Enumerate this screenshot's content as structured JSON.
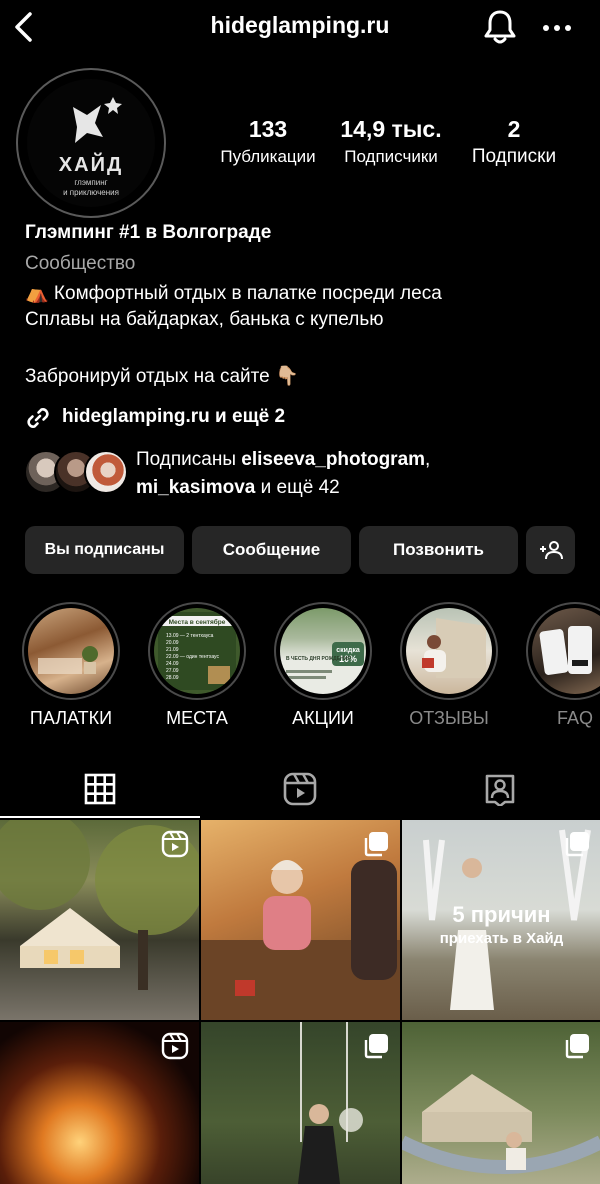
{
  "header": {
    "username": "hideglamping.ru"
  },
  "avatar": {
    "brand": "ХАЙД",
    "tagline1": "глэмпинг",
    "tagline2": "и приключения"
  },
  "stats": {
    "posts": {
      "value": "133",
      "label": "Публикации"
    },
    "followers": {
      "value": "14,9 тыс.",
      "label": "Подписчики"
    },
    "following": {
      "value": "2",
      "label": "Подписки"
    }
  },
  "bio": {
    "name": "Глэмпинг #1 в Волгограде",
    "category": "Сообщество",
    "line1": "⛺ Комфортный отдых в палатке посреди леса",
    "line2": "Сплавы на байдарках, банька с купелью",
    "line3": "Забронируй отдых на сайте 👇🏼"
  },
  "link": {
    "text": "hideglamping.ru и ещё 2"
  },
  "followed_by": {
    "prefix": "Подписаны ",
    "user1": "eliseeva_photogram",
    "comma": ",",
    "user2": "mi_kasimova",
    "suffix": " и ещё 42"
  },
  "actions": {
    "following": "Вы подписаны",
    "message": "Сообщение",
    "call": "Позвонить"
  },
  "highlights": [
    {
      "label": "ПАЛАТКИ"
    },
    {
      "label": "МЕСТА"
    },
    {
      "label": "АКЦИИ"
    },
    {
      "label": "ОТЗЫВЫ"
    },
    {
      "label": "FAQ"
    }
  ],
  "highlight_text": {
    "places_title": "Места в сентябре",
    "places_row1": "13.09 — 2 тентхауса",
    "places_row2": "20.09",
    "places_row3": "21.09",
    "places_row4": "22.09 — один тентхаус",
    "places_row5": "24.09",
    "places_row6": "27.09",
    "places_row7": "28.09",
    "promo_badge": "скидка",
    "promo_percent": "10%",
    "promo_caption": "В ЧЕСТЬ ДНЯ РОЖДЕНИЯ"
  },
  "posts": {
    "post3_title": "5 причин",
    "post3_subtitle": "приехать в Хайд"
  },
  "icons": {
    "back": "chevron-left-icon",
    "bell": "bell-icon",
    "more": "more-horizontal-icon",
    "link": "link-icon",
    "add_person": "add-person-icon",
    "grid": "grid-icon",
    "reels": "reels-icon",
    "tagged": "tagged-icon"
  },
  "colors": {
    "background": "#000000",
    "button": "#262626",
    "secondary_text": "#a8a8a8"
  }
}
